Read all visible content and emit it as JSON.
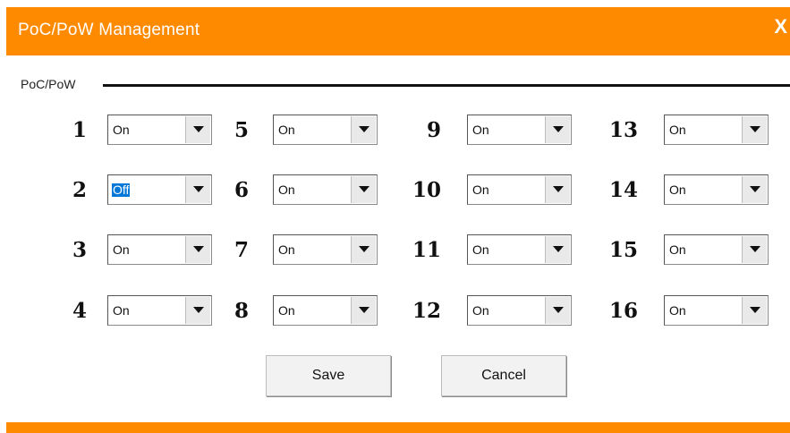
{
  "window": {
    "title": "PoC/PoW Management",
    "close_label": "X",
    "accent_color": "#fe8a00"
  },
  "group": {
    "label": "PoC/PoW"
  },
  "ports": [
    {
      "number": "1",
      "value": "On"
    },
    {
      "number": "2",
      "value": "Off",
      "focused": true
    },
    {
      "number": "3",
      "value": "On"
    },
    {
      "number": "4",
      "value": "On"
    },
    {
      "number": "5",
      "value": "On"
    },
    {
      "number": "6",
      "value": "On"
    },
    {
      "number": "7",
      "value": "On"
    },
    {
      "number": "8",
      "value": "On"
    },
    {
      "number": "9",
      "value": "On"
    },
    {
      "number": "10",
      "value": "On"
    },
    {
      "number": "11",
      "value": "On"
    },
    {
      "number": "12",
      "value": "On"
    },
    {
      "number": "13",
      "value": "On"
    },
    {
      "number": "14",
      "value": "On"
    },
    {
      "number": "15",
      "value": "On"
    },
    {
      "number": "16",
      "value": "On"
    }
  ],
  "buttons": {
    "save": "Save",
    "cancel": "Cancel"
  },
  "icons": {
    "close": "close-icon",
    "dropdown": "chevron-down-icon"
  }
}
